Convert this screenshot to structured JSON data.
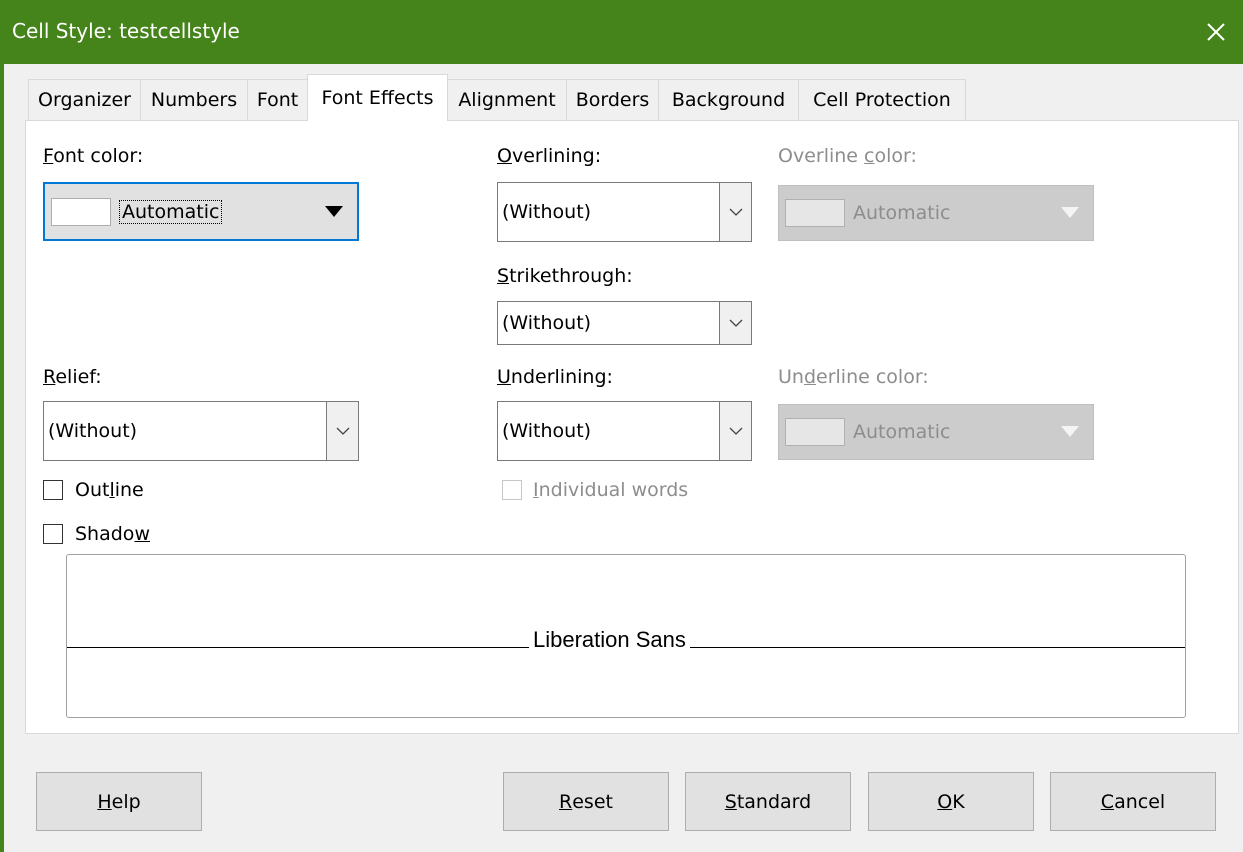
{
  "window": {
    "title": "Cell Style: testcellstyle",
    "close_icon": "close-icon",
    "accent_color": "#45831b"
  },
  "tabs": [
    {
      "label": "Organizer",
      "active": false
    },
    {
      "label": "Numbers",
      "active": false
    },
    {
      "label": "Font",
      "active": false
    },
    {
      "label": "Font Effects",
      "active": true
    },
    {
      "label": "Alignment",
      "active": false
    },
    {
      "label": "Borders",
      "active": false
    },
    {
      "label": "Background",
      "active": false
    },
    {
      "label": "Cell Protection",
      "active": false
    }
  ],
  "font_color": {
    "label_first": "F",
    "label_rest": "ont color:",
    "value": "Automatic"
  },
  "overlining": {
    "label_first": "O",
    "label_rest": "verlining:",
    "value": "(Without)"
  },
  "overline_color": {
    "label_before": "Overline ",
    "label_u": "c",
    "label_after": "olor:",
    "value": "Automatic",
    "disabled": true
  },
  "strikethrough": {
    "label_first": "S",
    "label_rest": "trikethrough:",
    "value": "(Without)"
  },
  "relief": {
    "label_first": "R",
    "label_rest": "elief:",
    "value": "(Without)"
  },
  "underlining": {
    "label_first": "U",
    "label_rest": "nderlining:",
    "value": "(Without)"
  },
  "underline_color": {
    "label_before": "Un",
    "label_u": "d",
    "label_after": "erline color:",
    "value": "Automatic",
    "disabled": true
  },
  "outline": {
    "label_before": "Out",
    "label_u": "l",
    "label_after": "ine",
    "checked": false
  },
  "shadow": {
    "label_before": "Shado",
    "label_u": "w",
    "label_after": "",
    "checked": false
  },
  "individual_words": {
    "label_first": "I",
    "label_rest": "ndividual words",
    "checked": false,
    "disabled": true
  },
  "preview": {
    "text": "Liberation Sans"
  },
  "buttons": {
    "help": {
      "u": "H",
      "rest": "elp"
    },
    "reset": {
      "u": "R",
      "rest": "eset"
    },
    "standard": {
      "u": "S",
      "rest": "tandard"
    },
    "ok": {
      "u": "O",
      "rest": "K"
    },
    "cancel": {
      "u": "C",
      "rest": "ancel"
    }
  }
}
